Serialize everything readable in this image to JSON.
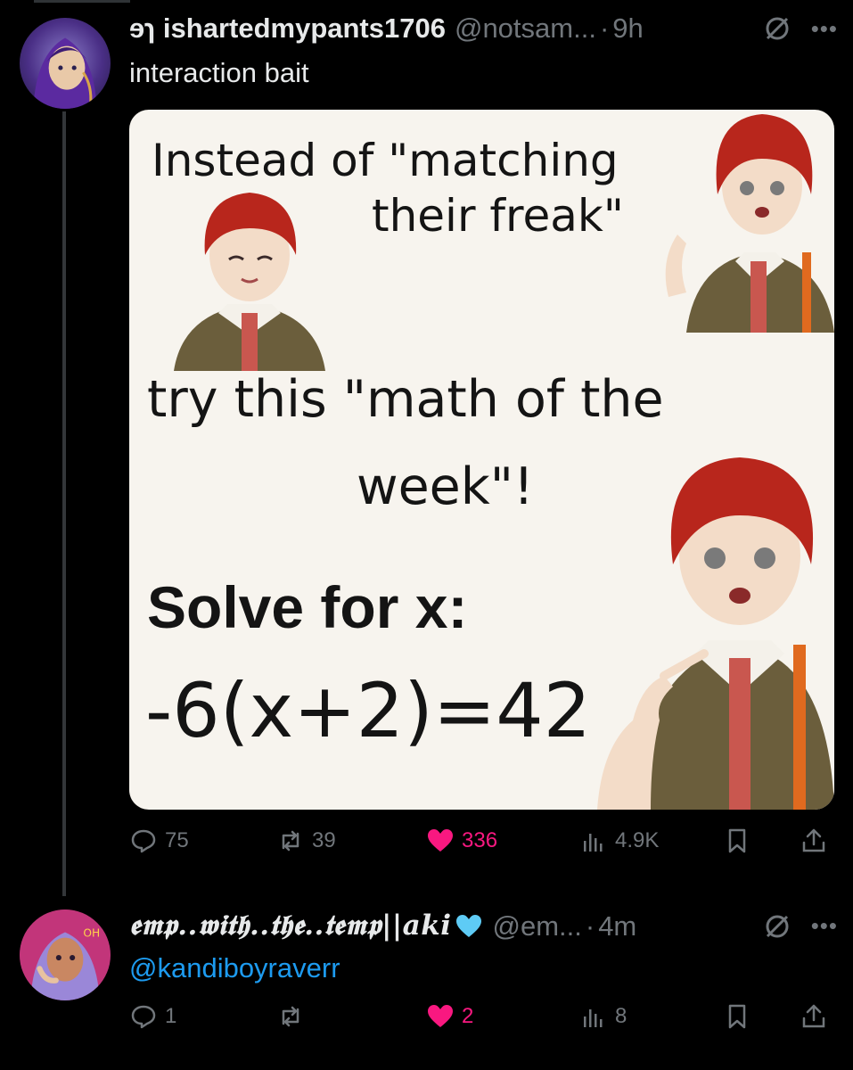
{
  "tweet1": {
    "display_name": "ɘɿ ishartedmypants1706",
    "handle": "@notsam...",
    "time": "9h",
    "text": "interaction bait",
    "media": {
      "line1": "Instead of \"matching",
      "line2": "their freak\"",
      "line3": "try this \"math of the",
      "line4": "week\"!",
      "solve": "Solve for x:",
      "equation": "-6(x+2)=42"
    },
    "actions": {
      "replies": "75",
      "reposts": "39",
      "likes": "336",
      "views": "4.9K"
    }
  },
  "tweet2": {
    "display_name": "𝖊𝖒𝖕..𝖜𝖎𝖙𝖍..𝖙𝖍𝖊..𝖙𝖊𝖒𝖕||aki",
    "handle": "@em...",
    "time": "4m",
    "text": "@kandiboyraverr",
    "actions": {
      "replies": "1",
      "reposts": "",
      "likes": "2",
      "views": "8"
    }
  },
  "colors": {
    "background": "#000000",
    "text": "#e7e9ea",
    "muted": "#71767b",
    "like": "#f91880",
    "link": "#1d9bf0",
    "heart_badge": "#5ecbf5"
  },
  "icons": [
    "grok-icon",
    "more-icon",
    "reply-icon",
    "repost-icon",
    "like-icon",
    "views-icon",
    "bookmark-icon",
    "share-icon"
  ]
}
